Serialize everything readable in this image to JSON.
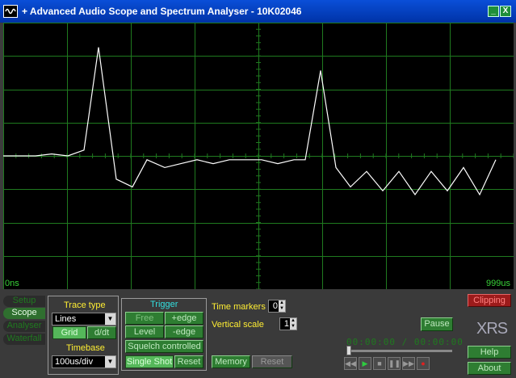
{
  "window": {
    "title": "+ Advanced Audio Scope and Spectrum Analyser - 10K02046",
    "min_label": "_",
    "close_label": "X"
  },
  "scope": {
    "time_start": "0ns",
    "time_end": "999us",
    "grid_color": "#1f7a1f",
    "trace_color": "#ffffff",
    "trace": [
      [
        0,
        0
      ],
      [
        20,
        0
      ],
      [
        40,
        0
      ],
      [
        60,
        0.5
      ],
      [
        80,
        0
      ],
      [
        100,
        1.5
      ],
      [
        118,
        28
      ],
      [
        140,
        -6
      ],
      [
        160,
        -8
      ],
      [
        178,
        -1
      ],
      [
        200,
        -3
      ],
      [
        220,
        -2
      ],
      [
        240,
        -1
      ],
      [
        260,
        -2
      ],
      [
        280,
        -1
      ],
      [
        300,
        -1
      ],
      [
        320,
        -1
      ],
      [
        340,
        -2
      ],
      [
        360,
        -1
      ],
      [
        374,
        -1
      ],
      [
        393,
        22
      ],
      [
        412,
        -3
      ],
      [
        430,
        -8
      ],
      [
        450,
        -4
      ],
      [
        470,
        -9
      ],
      [
        490,
        -4
      ],
      [
        510,
        -10
      ],
      [
        530,
        -4
      ],
      [
        550,
        -9
      ],
      [
        570,
        -3
      ],
      [
        590,
        -10
      ],
      [
        610,
        -1
      ]
    ]
  },
  "sidebar": {
    "tabs": [
      "Setup",
      "Scope",
      "Analyser",
      "Waterfall"
    ],
    "active": 1
  },
  "trace_type": {
    "label": "Trace type",
    "value": "Lines",
    "grid_button": "Grid",
    "ddt_button": "d/dt"
  },
  "timebase": {
    "label": "Timebase",
    "value": "100us/div"
  },
  "trigger": {
    "label": "Trigger",
    "free": "Free",
    "plus_edge": "+edge",
    "level": "Level",
    "minus_edge": "-edge",
    "squelch": "Squelch controlled",
    "single_shot": "Single Shot",
    "reset": "Reset"
  },
  "markers": {
    "time_markers_label": "Time markers",
    "time_markers_value": "0",
    "vertical_scale_label": "Vertical scale",
    "vertical_scale_value": "1"
  },
  "memory": {
    "memory_label": "Memory",
    "reset_label": "Reset"
  },
  "playback": {
    "time_display": "00:00:00 / 00:00:00",
    "pause_label": "Pause",
    "transport_icons": [
      "rewind-icon",
      "play-icon",
      "stop-icon",
      "pause-icon",
      "fast-forward-icon",
      "record-icon"
    ]
  },
  "right": {
    "clipping_label": "Clipping",
    "logo": "XRS",
    "help_label": "Help",
    "about_label": "About"
  }
}
